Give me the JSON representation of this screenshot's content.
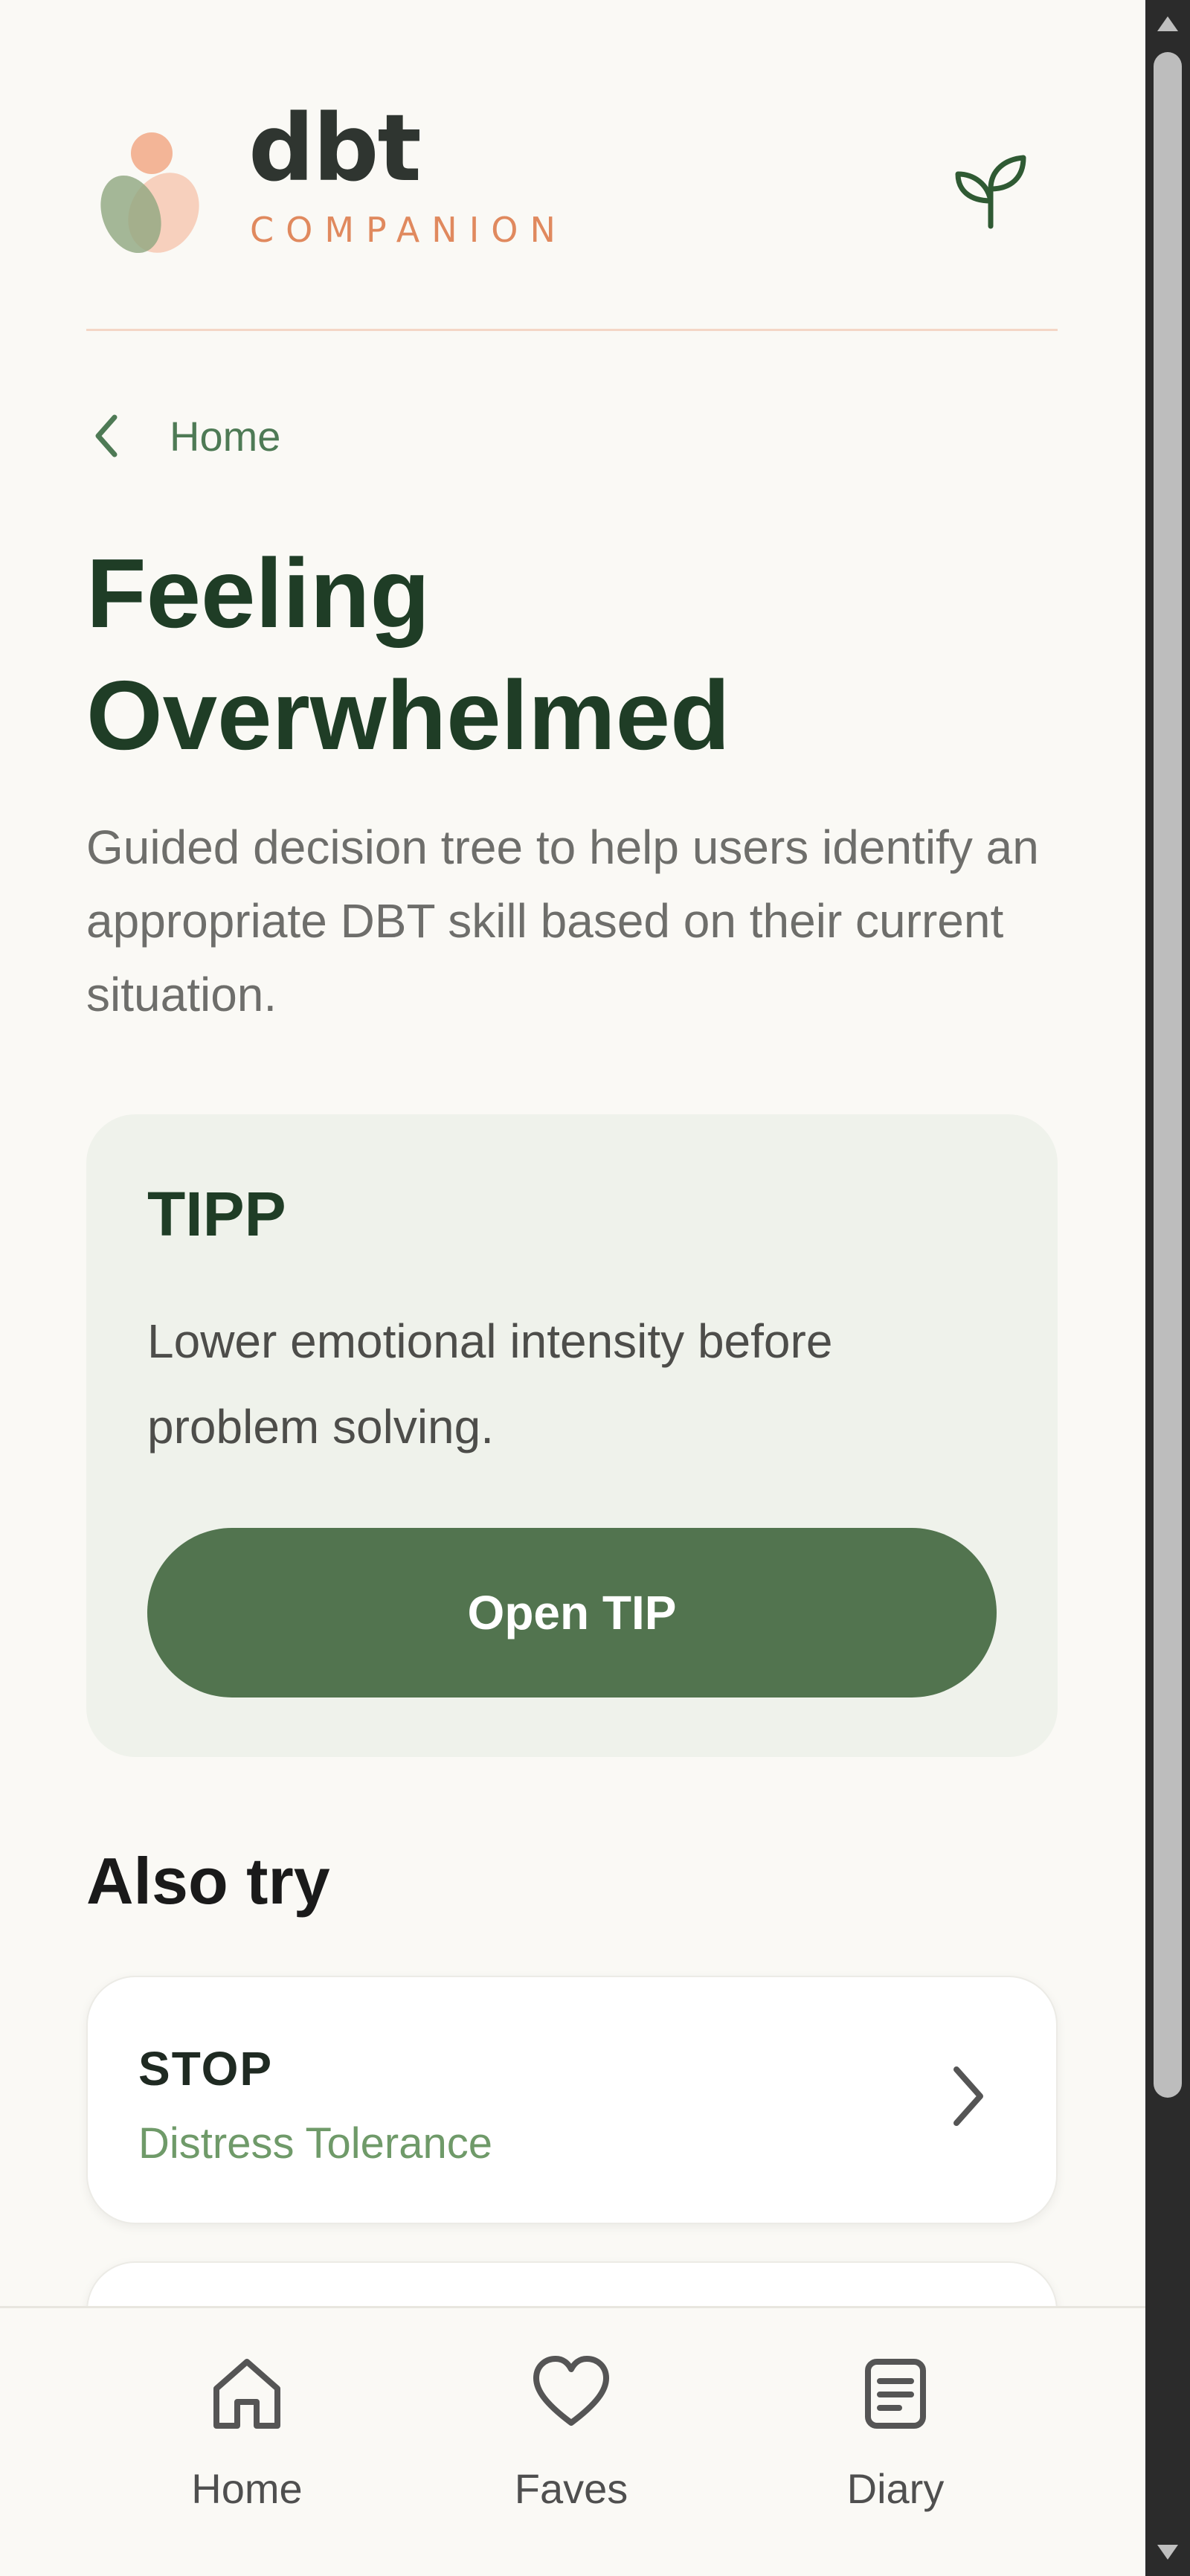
{
  "brand": {
    "name": "dbt",
    "subtitle": "COMPANION"
  },
  "breadcrumb": {
    "back_label": "Home"
  },
  "page": {
    "title": "Feeling Overwhelmed",
    "description": "Guided decision tree to help users identify an appropriate DBT skill based on their current situation."
  },
  "primary_skill": {
    "name": "TIPP",
    "summary": "Lower emotional intensity before problem solving.",
    "button_label": "Open TIP"
  },
  "also_try": {
    "heading": "Also try",
    "items": [
      {
        "name": "STOP",
        "category": "Distress Tolerance"
      }
    ]
  },
  "bottom_nav": {
    "items": [
      {
        "label": "Home",
        "icon": "home-icon"
      },
      {
        "label": "Faves",
        "icon": "heart-icon"
      },
      {
        "label": "Diary",
        "icon": "diary-icon"
      }
    ]
  },
  "colors": {
    "background": "#faf9f5",
    "primary_green": "#52744f",
    "dark_green": "#1f3d26",
    "accent_peach": "#e0895e",
    "card_background": "#eff2eb"
  }
}
